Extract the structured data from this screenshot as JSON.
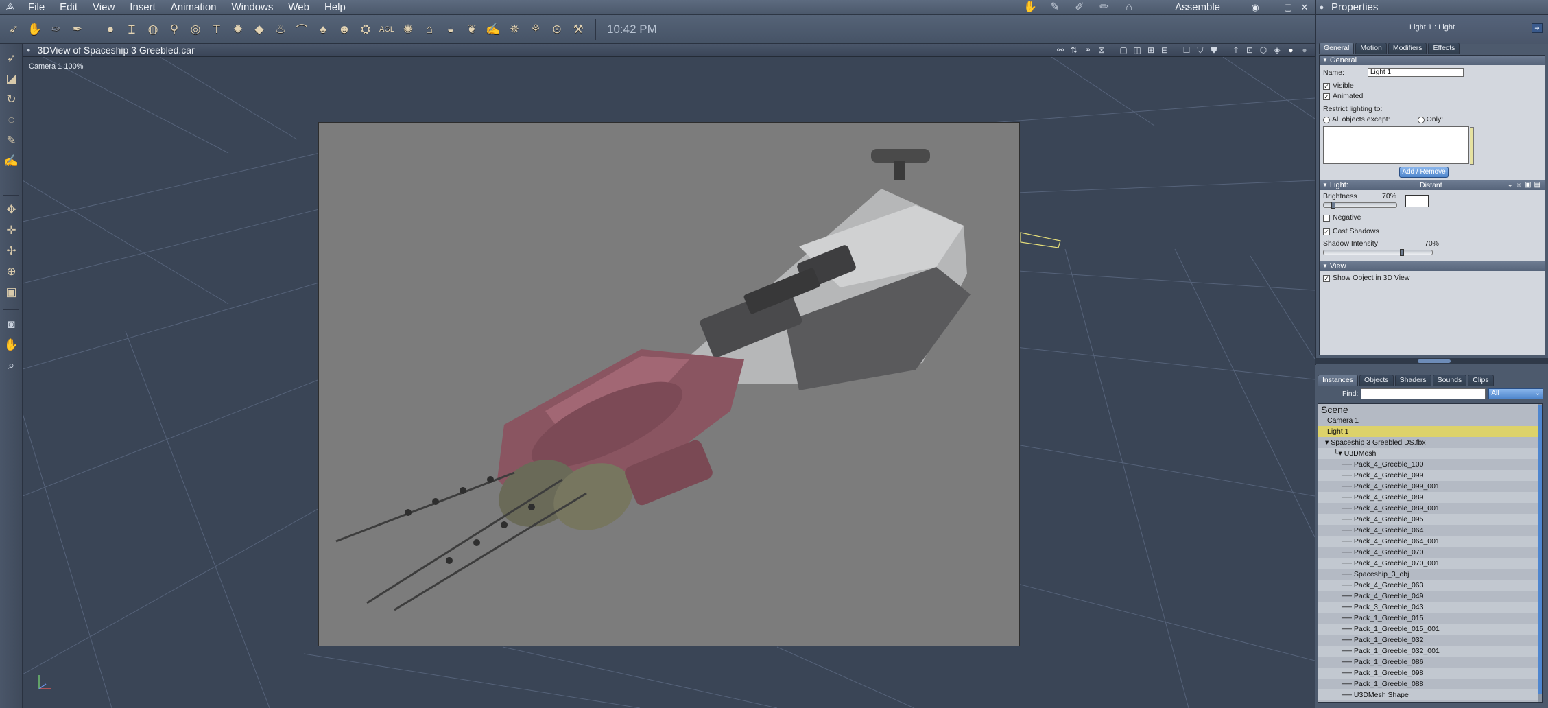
{
  "menubar": {
    "items": [
      "File",
      "Edit",
      "View",
      "Insert",
      "Animation",
      "Windows",
      "Web",
      "Help"
    ],
    "room_label": "Assemble",
    "room_icons": [
      "hand-room-icon",
      "pose-room-icon",
      "material-room-icon",
      "paint-room-icon",
      "render-room-icon"
    ]
  },
  "toolbar": {
    "time": "10:42 PM",
    "tools": [
      "pointer",
      "hand",
      "brush",
      "paint",
      "sphere",
      "cylinder",
      "torus",
      "bone",
      "ring",
      "text",
      "gear",
      "disc",
      "lamp",
      "hat",
      "scoop",
      "head",
      "vehicle",
      "box",
      "agl",
      "spiral",
      "house",
      "dome",
      "leaf",
      "spider",
      "tree",
      "pin",
      "bone2"
    ]
  },
  "viewport": {
    "title": "3DView of Spaceship 3 Greebled.car",
    "camera_label": "Camera 1 100%"
  },
  "properties": {
    "title": "Properties",
    "object_name": "Light 1 : Light",
    "tabs": [
      "General",
      "Motion",
      "Modifiers",
      "Effects"
    ],
    "general": {
      "section": "General",
      "name_label": "Name:",
      "name_value": "Light 1",
      "visible": "Visible",
      "animated": "Animated",
      "restrict_label": "Restrict lighting to:",
      "all_except": "All objects except:",
      "only": "Only:",
      "add_remove": "Add / Remove"
    },
    "light": {
      "section": "Light:",
      "type": "Distant",
      "brightness_label": "Brightness",
      "brightness_value": "70%",
      "brightness": 0.7,
      "negative": "Negative",
      "cast_shadows": "Cast Shadows",
      "shadow_label": "Shadow Intensity",
      "shadow_value": "70%",
      "shadow": 0.7
    },
    "view": {
      "section": "View",
      "show_object": "Show Object in 3D View"
    }
  },
  "scene_panel": {
    "tabs": [
      "Instances",
      "Objects",
      "Shaders",
      "Sounds",
      "Clips"
    ],
    "find_label": "Find:",
    "filter": "All",
    "scene_title": "Scene",
    "nodes": [
      {
        "label": "Camera 1",
        "indent": 0,
        "prefix": ""
      },
      {
        "label": "Light 1",
        "indent": 0,
        "prefix": "",
        "selected": true
      },
      {
        "label": "Spaceship 3 Greebled DS.fbx",
        "indent": 0,
        "prefix": "▾"
      },
      {
        "label": "U3DMesh",
        "indent": 1,
        "prefix": "└▾"
      },
      {
        "label": "Pack_4_Greeble_100",
        "indent": 2,
        "prefix": "──"
      },
      {
        "label": "Pack_4_Greeble_099",
        "indent": 2,
        "prefix": "──"
      },
      {
        "label": "Pack_4_Greeble_099_001",
        "indent": 2,
        "prefix": "──"
      },
      {
        "label": "Pack_4_Greeble_089",
        "indent": 2,
        "prefix": "──"
      },
      {
        "label": "Pack_4_Greeble_089_001",
        "indent": 2,
        "prefix": "──"
      },
      {
        "label": "Pack_4_Greeble_095",
        "indent": 2,
        "prefix": "──"
      },
      {
        "label": "Pack_4_Greeble_064",
        "indent": 2,
        "prefix": "──"
      },
      {
        "label": "Pack_4_Greeble_064_001",
        "indent": 2,
        "prefix": "──"
      },
      {
        "label": "Pack_4_Greeble_070",
        "indent": 2,
        "prefix": "──"
      },
      {
        "label": "Pack_4_Greeble_070_001",
        "indent": 2,
        "prefix": "──"
      },
      {
        "label": "Spaceship_3_obj",
        "indent": 2,
        "prefix": "──"
      },
      {
        "label": "Pack_4_Greeble_063",
        "indent": 2,
        "prefix": "──"
      },
      {
        "label": "Pack_4_Greeble_049",
        "indent": 2,
        "prefix": "──"
      },
      {
        "label": "Pack_3_Greeble_043",
        "indent": 2,
        "prefix": "──"
      },
      {
        "label": "Pack_1_Greeble_015",
        "indent": 2,
        "prefix": "──"
      },
      {
        "label": "Pack_1_Greeble_015_001",
        "indent": 2,
        "prefix": "──"
      },
      {
        "label": "Pack_1_Greeble_032",
        "indent": 2,
        "prefix": "──"
      },
      {
        "label": "Pack_1_Greeble_032_001",
        "indent": 2,
        "prefix": "──"
      },
      {
        "label": "Pack_1_Greeble_086",
        "indent": 2,
        "prefix": "──"
      },
      {
        "label": "Pack_1_Greeble_098",
        "indent": 2,
        "prefix": "──"
      },
      {
        "label": "Pack_1_Greeble_088",
        "indent": 2,
        "prefix": "──"
      },
      {
        "label": "U3DMesh Shape",
        "indent": 2,
        "prefix": "──"
      }
    ]
  }
}
